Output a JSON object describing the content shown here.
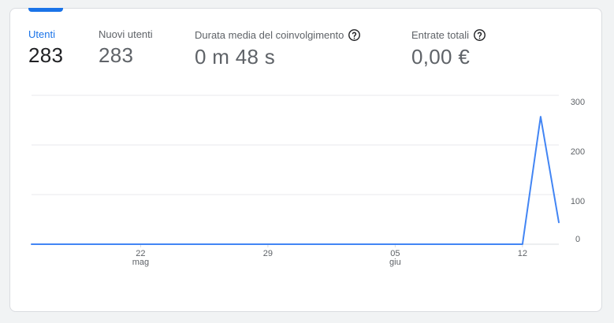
{
  "metrics": [
    {
      "label": "Utenti",
      "value": "283",
      "active": true,
      "help": false
    },
    {
      "label": "Nuovi utenti",
      "value": "283",
      "active": false,
      "help": false
    },
    {
      "label": "Durata media del coinvolgimento",
      "value": "0 m 48 s",
      "active": false,
      "help": true
    },
    {
      "label": "Entrate totali",
      "value": "0,00 €",
      "active": false,
      "help": true
    }
  ],
  "colors": {
    "accent": "#1a73e8",
    "line": "#4285f4",
    "grid": "#e8eaed",
    "baseline": "#dadce0",
    "tick_text": "#5f6368"
  },
  "chart_data": {
    "type": "line",
    "x_ticks": [
      {
        "day": "22",
        "month": "mag"
      },
      {
        "day": "29",
        "month": ""
      },
      {
        "day": "05",
        "month": "giu"
      },
      {
        "day": "12",
        "month": ""
      }
    ],
    "y_ticks": [
      "300",
      "200",
      "100",
      "0"
    ],
    "ylim": [
      0,
      300
    ],
    "grid": true,
    "series": [
      {
        "x": [
          "2024-05-16",
          "2024-05-17",
          "2024-05-18",
          "2024-05-19",
          "2024-05-20",
          "2024-05-21",
          "2024-05-22",
          "2024-05-23",
          "2024-05-24",
          "2024-05-25",
          "2024-05-26",
          "2024-05-27",
          "2024-05-28",
          "2024-05-29",
          "2024-05-30",
          "2024-05-31",
          "2024-06-01",
          "2024-06-02",
          "2024-06-03",
          "2024-06-04",
          "2024-06-05",
          "2024-06-06",
          "2024-06-07",
          "2024-06-08",
          "2024-06-09",
          "2024-06-10",
          "2024-06-11",
          "2024-06-12",
          "2024-06-13",
          "2024-06-14"
        ],
        "values": [
          0,
          0,
          0,
          0,
          0,
          0,
          0,
          0,
          0,
          0,
          0,
          0,
          0,
          0,
          0,
          0,
          0,
          0,
          0,
          0,
          0,
          0,
          0,
          0,
          0,
          0,
          0,
          0,
          257,
          44
        ]
      }
    ]
  }
}
